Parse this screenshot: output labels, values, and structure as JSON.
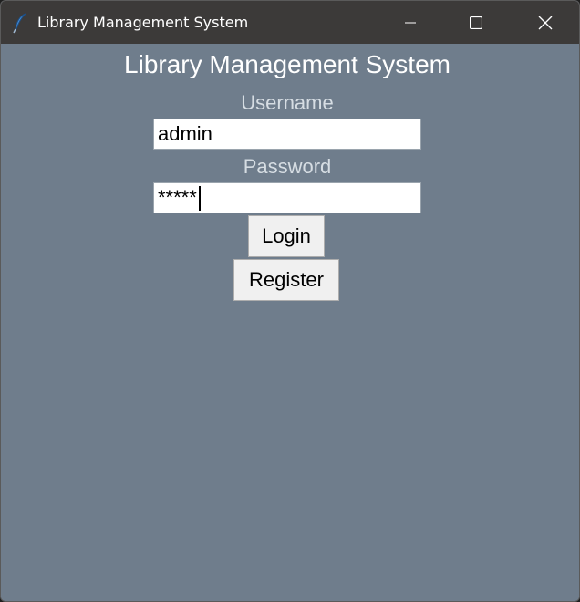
{
  "window": {
    "title": "Library Management System",
    "controls": {
      "minimize": "minimize-icon",
      "maximize": "maximize-icon",
      "close": "close-icon"
    }
  },
  "form": {
    "heading": "Library Management System",
    "username_label": "Username",
    "username_value": "admin",
    "password_label": "Password",
    "password_value": "*****",
    "login_label": "Login",
    "register_label": "Register"
  },
  "colors": {
    "titlebar": "#3c3a39",
    "background": "#6f7d8c",
    "heading_text": "#ffffff",
    "label_text": "#d6dde3",
    "button_face": "#f0f0f0"
  }
}
